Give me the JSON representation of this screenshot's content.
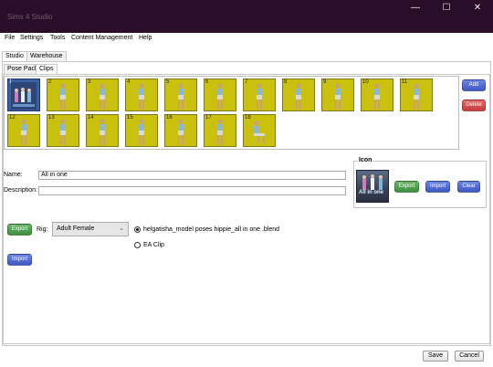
{
  "window": {
    "title": "Sims 4 Studio",
    "controls": {
      "minimize": "—",
      "maximize": "☐",
      "close": "✕"
    }
  },
  "menu": [
    "File",
    "Settings",
    "Tools",
    "Content Management",
    "Help"
  ],
  "top_tabs": [
    "Studio",
    "Warehouse"
  ],
  "sub_tabs": [
    "Pose Pack",
    "Clips"
  ],
  "clips": [
    "1",
    "2",
    "3",
    "4",
    "5",
    "6",
    "7",
    "8",
    "9",
    "10",
    "11",
    "12",
    "13",
    "14",
    "15",
    "16",
    "17",
    "18"
  ],
  "side_buttons": {
    "add": "Add",
    "delete": "Delete"
  },
  "form": {
    "name_label": "Name:",
    "name_value": "All in one",
    "description_label": "Description:",
    "description_value": ""
  },
  "icon_group": {
    "legend": "Icon",
    "image_caption": "All in one",
    "export": "Export",
    "import": "Import",
    "clear": "Clear"
  },
  "export_row": {
    "export": "Export",
    "rig_label": "Rig:",
    "rig_value": "Adult Female",
    "radio_blend": "helgatisha_model poses hippie_all in one .blend",
    "radio_ea": "EA Clip",
    "import": "Import"
  },
  "footer": {
    "save": "Save",
    "cancel": "Cancel"
  },
  "colors": {
    "titlebar": "#2a0d29",
    "thumb_bg": "#c9c10d",
    "accent_blue": "#3e58c6",
    "accent_red": "#c63b3b",
    "accent_green": "#3d8f3d"
  }
}
